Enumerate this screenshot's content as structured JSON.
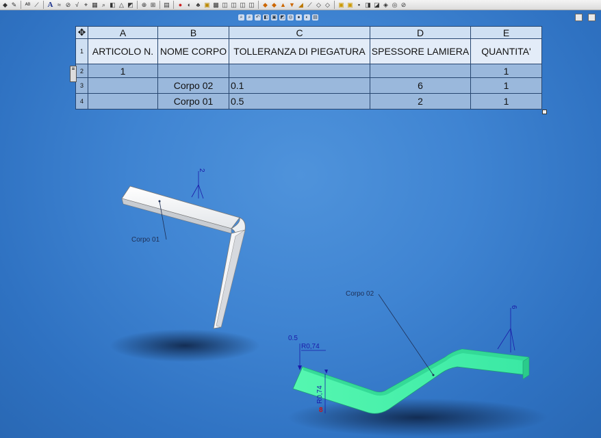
{
  "table": {
    "columns": [
      "A",
      "B",
      "C",
      "D",
      "E"
    ],
    "headers": {
      "item_no": "ARTICOLO N.",
      "body_name": "NOME CORPO",
      "bend_tolerance": "TOLLERANZA DI PIEGATURA",
      "sheet_thickness": "SPESSORE LAMIERA",
      "quantity": "QUANTITA'"
    },
    "row_numbers": [
      "1",
      "2",
      "3",
      "4"
    ],
    "rows": [
      {
        "item_no": "1",
        "body_name": "",
        "bend_tolerance": "",
        "sheet_thickness": "",
        "quantity": "1"
      },
      {
        "item_no": "",
        "body_name": "Corpo 02",
        "bend_tolerance": "0.1",
        "sheet_thickness": "6",
        "quantity": "1"
      },
      {
        "item_no": "",
        "body_name": "Corpo 01",
        "bend_tolerance": "0.5",
        "sheet_thickness": "2",
        "quantity": "1"
      }
    ]
  },
  "viewport": {
    "callouts": {
      "corpo01": "Corpo 01",
      "corpo02": "Corpo 02"
    },
    "dimensions": {
      "thickness_01": "2",
      "thickness_02": "6",
      "tolerance_02": "0.5",
      "radius_02": "R0,74",
      "radius_02_vertical": "R0,74",
      "marker": "8"
    }
  },
  "icons": {
    "toolbar": [
      "pointer-icon",
      "rebuild-icon",
      "spell-icon",
      "smart-dimension-icon",
      "note-icon",
      "text-icon",
      "balloon-icon",
      "surface-finish-icon",
      "datum-icon",
      "table-icon",
      "zoom-icon",
      "rotate-icon",
      "view-icon",
      "shading-icon",
      "section-icon",
      "sheet-metal-icon",
      "flatten-icon",
      "fold-icon",
      "weldment-icon"
    ],
    "corner": "move-table-icon"
  },
  "colors": {
    "background": "#3f84d2",
    "header_cell": "#e3ecf8",
    "body_cell": "#9ab8dc",
    "part_white": "#f2f2f2",
    "part_green": "#3ff2a8"
  }
}
